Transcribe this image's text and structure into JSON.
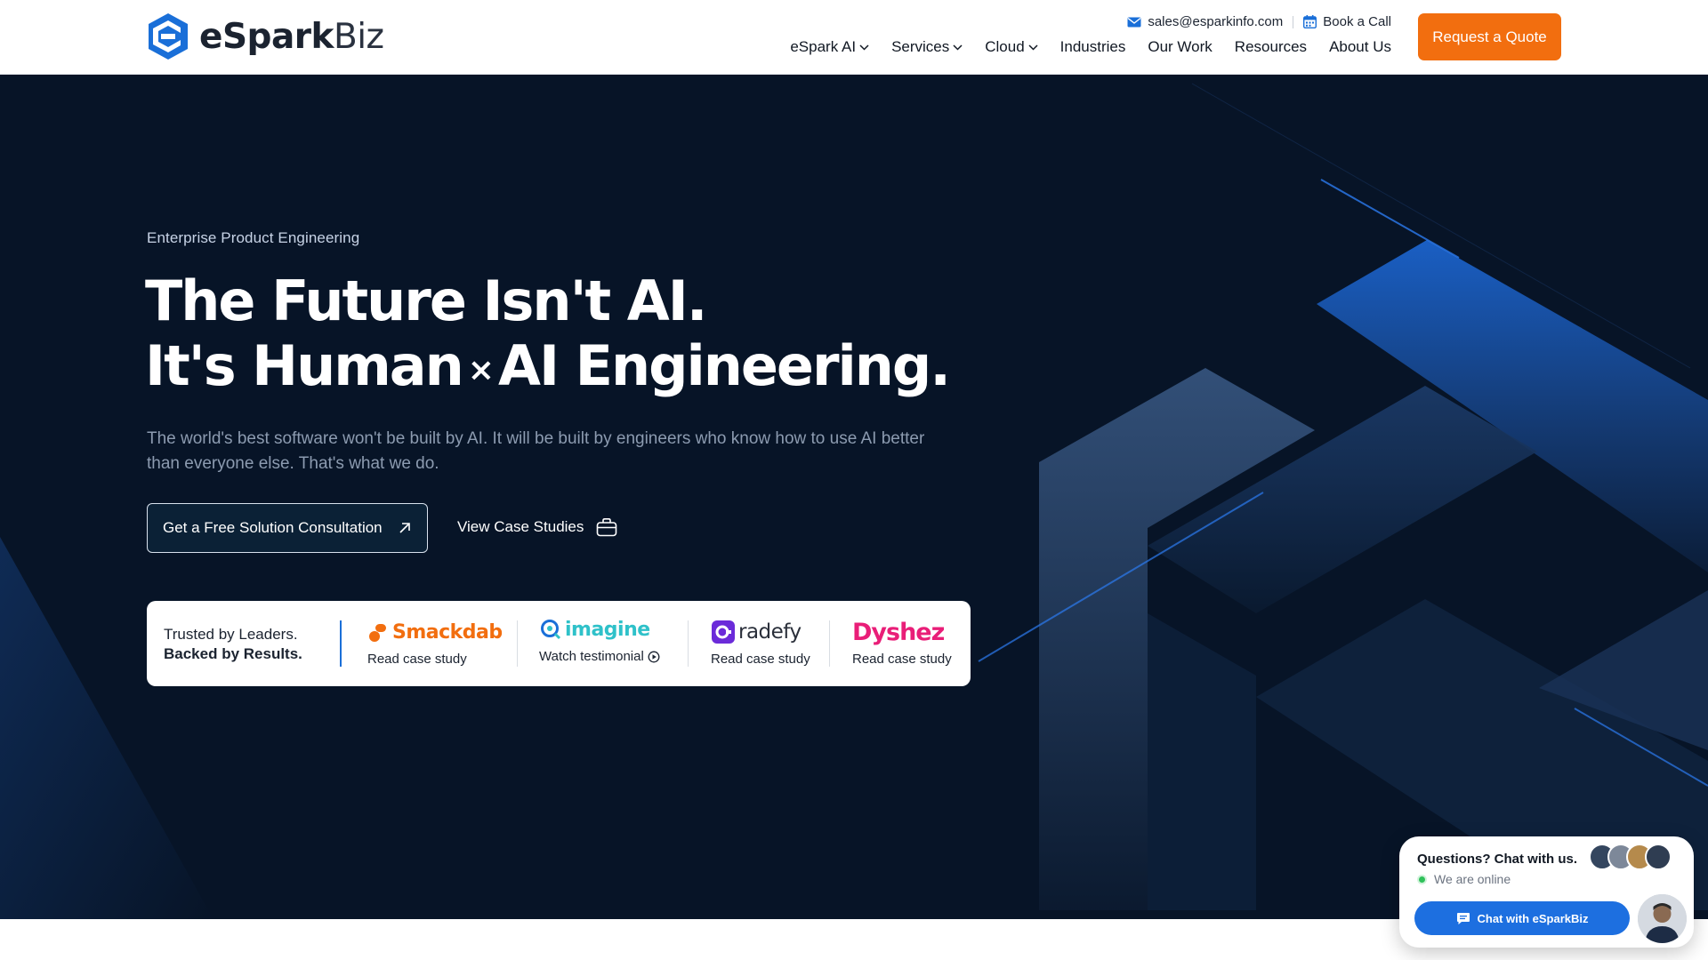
{
  "header": {
    "logo": {
      "name_bold": "eSpark",
      "name_light": "Biz"
    },
    "contacts": {
      "email": "sales@esparkinfo.com",
      "call": "Book a Call"
    },
    "nav": [
      {
        "label": "eSpark AI",
        "has_dropdown": true
      },
      {
        "label": "Services",
        "has_dropdown": true
      },
      {
        "label": "Cloud",
        "has_dropdown": true
      },
      {
        "label": "Industries",
        "has_dropdown": false
      },
      {
        "label": "Our Work",
        "has_dropdown": false
      },
      {
        "label": "Resources",
        "has_dropdown": false
      },
      {
        "label": "About Us",
        "has_dropdown": false
      }
    ],
    "quote_button": "Request a Quote"
  },
  "hero": {
    "eyebrow": "Enterprise Product Engineering",
    "headline_line1": "The Future Isn't AI.",
    "headline_line2_part1": "It's Human",
    "headline_times": "×",
    "headline_line2_part2": "AI Engineering.",
    "subcopy": "The world's best software won't be built by AI. It will be built by engineers who know how to use AI better than everyone else. That's what we do.",
    "cta_primary": "Get a Free Solution Consultation",
    "cta_secondary": "View Case Studies"
  },
  "trust": {
    "label_line1": "Trusted by Leaders.",
    "label_line2": "Backed by Results.",
    "brands": [
      {
        "name": "Smackdab",
        "link": "Read case study",
        "color": "#f26e0f"
      },
      {
        "name": "imagine",
        "link": "Watch testimonial",
        "color": "#2fc1c9"
      },
      {
        "name": "radefy",
        "link": "Read case study",
        "color": "#6b2bd9"
      },
      {
        "name": "Dyshez",
        "link": "Read case study",
        "color": "#e91e78"
      }
    ]
  },
  "chat": {
    "title": "Questions? Chat with us.",
    "status": "We are online",
    "button": "Chat with eSparkBiz"
  },
  "colors": {
    "brand_orange": "#f26e0f",
    "hero_bg": "#071427",
    "accent_blue": "#1d6fe0"
  }
}
